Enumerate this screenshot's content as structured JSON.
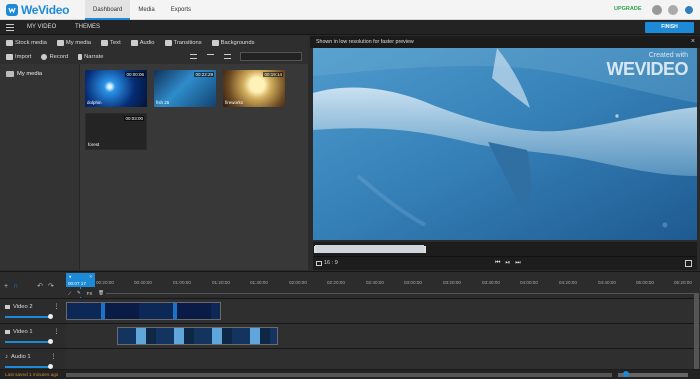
{
  "top_bar": {
    "logo": "WeVideo",
    "nav": [
      "Dashboard",
      "Media",
      "Exports"
    ],
    "upgrade": "UPGRADE"
  },
  "menu_bar": {
    "project": "MY VIDEO",
    "themes": "THEMES",
    "finish": "FINISH"
  },
  "media_panel": {
    "tabs": [
      "Stock media",
      "My media",
      "Text",
      "Audio",
      "Transitions",
      "Backgrounds"
    ],
    "actions": [
      "Import",
      "Record",
      "Narrate"
    ],
    "sidebar": [
      "My media"
    ],
    "assets": [
      {
        "name": "dolphin",
        "duration": "00:00:06"
      },
      {
        "name": "fish 25",
        "duration": "00:22:29"
      },
      {
        "name": "fireworks",
        "duration": "00:19:14"
      },
      {
        "name": "forest",
        "duration": "00:03:00"
      }
    ]
  },
  "preview": {
    "notice": "Shown in low resolution for faster preview",
    "watermark_small": "Created with",
    "watermark_big": "WEVIDEO",
    "aspect_ratio": "16 : 9"
  },
  "timeline": {
    "current_time": "00:07:17",
    "ticks": [
      "00:00:00",
      "00:20:00",
      "00:40:00",
      "01:00:00",
      "01:20:00",
      "01:40:00",
      "02:00:00",
      "02:20:00",
      "02:40:00",
      "03:00:00",
      "03:20:00",
      "03:40:00",
      "04:00:00",
      "04:20:00",
      "04:40:00",
      "05:00:00",
      "05:20:00",
      "05:40:00",
      "06:00:00",
      "06:20:00"
    ],
    "tracks": [
      "Video 2",
      "Video 1",
      "Audio 1"
    ],
    "edit_tools": [
      "✎",
      "FX",
      "🗑"
    ],
    "saved": "Last saved 1 minutes ago"
  }
}
